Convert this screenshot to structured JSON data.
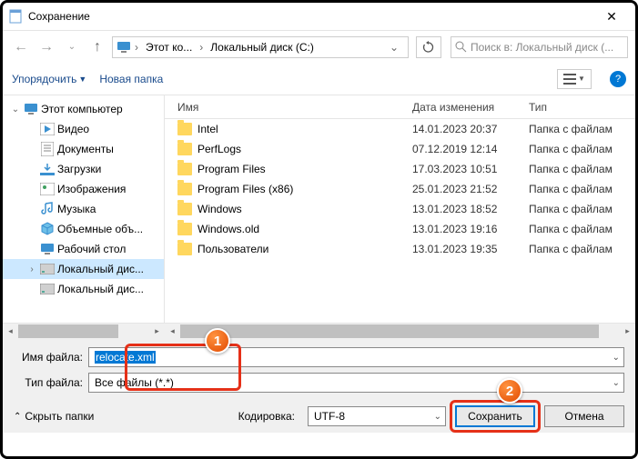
{
  "window": {
    "title": "Сохранение"
  },
  "nav": {
    "breadcrumb": [
      "Этот ко...",
      "Локальный диск (C:)"
    ],
    "search_placeholder": "Поиск в: Локальный диск (..."
  },
  "toolbar": {
    "organize": "Упорядочить",
    "new_folder": "Новая папка"
  },
  "tree": {
    "root": "Этот компьютер",
    "items": [
      {
        "icon": "video",
        "label": "Видео"
      },
      {
        "icon": "doc",
        "label": "Документы"
      },
      {
        "icon": "download",
        "label": "Загрузки"
      },
      {
        "icon": "image",
        "label": "Изображения"
      },
      {
        "icon": "music",
        "label": "Музыка"
      },
      {
        "icon": "cube",
        "label": "Объемные объ..."
      },
      {
        "icon": "desktop",
        "label": "Рабочий стол"
      },
      {
        "icon": "disk",
        "label": "Локальный дис...",
        "selected": true
      },
      {
        "icon": "disk",
        "label": "Локальный дис..."
      }
    ]
  },
  "columns": {
    "name": "Имя",
    "date": "Дата изменения",
    "type": "Тип"
  },
  "files": [
    {
      "name": "Intel",
      "date": "14.01.2023 20:37",
      "type": "Папка с файлам"
    },
    {
      "name": "PerfLogs",
      "date": "07.12.2019 12:14",
      "type": "Папка с файлам"
    },
    {
      "name": "Program Files",
      "date": "17.03.2023 10:51",
      "type": "Папка с файлам"
    },
    {
      "name": "Program Files (x86)",
      "date": "25.01.2023 21:52",
      "type": "Папка с файлам"
    },
    {
      "name": "Windows",
      "date": "13.01.2023 18:52",
      "type": "Папка с файлам"
    },
    {
      "name": "Windows.old",
      "date": "13.01.2023 19:16",
      "type": "Папка с файлам"
    },
    {
      "name": "Пользователи",
      "date": "13.01.2023 19:35",
      "type": "Папка с файлам"
    }
  ],
  "form": {
    "filename_label": "Имя файла:",
    "filename_value": "relocate.xml",
    "filetype_label": "Тип файла:",
    "filetype_value": "Все файлы  (*.*)",
    "hide_folders": "Скрыть папки",
    "encoding_label": "Кодировка:",
    "encoding_value": "UTF-8",
    "save": "Сохранить",
    "cancel": "Отмена"
  },
  "badges": {
    "b1": "1",
    "b2": "2"
  }
}
